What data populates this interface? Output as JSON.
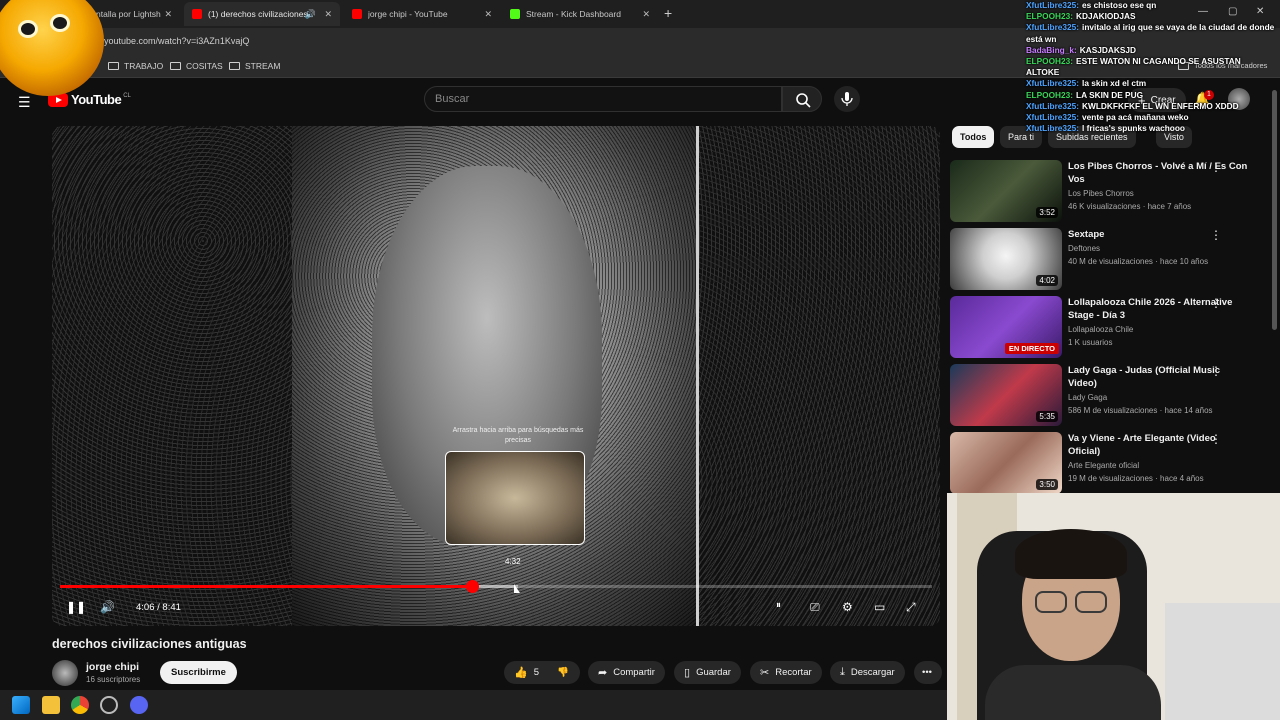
{
  "browser": {
    "tabs": [
      {
        "label": "ntalla por Lightsh",
        "active": false
      },
      {
        "label": "(1) derechos civilizaciones a",
        "active": true
      },
      {
        "label": "jorge chipi - YouTube",
        "active": false
      },
      {
        "label": "Stream - Kick Dashboard",
        "active": false
      }
    ],
    "url": "youtube.com/watch?v=i3AZn1KvajQ",
    "bookmarks": [
      "TRABAJO",
      "COSITAS",
      "STREAM"
    ],
    "all_bookmarks": "Todos los marcadores"
  },
  "youtube": {
    "logo": "YouTube",
    "country": "CL",
    "search_placeholder": "Buscar",
    "create_label": "Crear",
    "notif_count": "1"
  },
  "player": {
    "current_time": "4:06",
    "duration": "8:41",
    "time_display": "4:06 / 8:41",
    "progress_fraction": 0.473,
    "hover_time": "4:32",
    "hover_fraction": 0.525,
    "drag_hint": "Arrastra hacia arriba para búsquedas más precisas"
  },
  "video": {
    "title": "derechos civilizaciones antiguas",
    "channel": "jorge chipi",
    "subscribers": "16 suscriptores",
    "subscribe_label": "Suscribirme",
    "likes": "5",
    "share": "Compartir",
    "save": "Guardar",
    "clip": "Recortar",
    "download": "Descargar"
  },
  "sidebar": {
    "chips": [
      "Todos",
      "Para ti",
      "Subidas recientes",
      "Visto"
    ],
    "recs": [
      {
        "title": "Los Pibes Chorros - Volvé a Mí / Es Con Vos",
        "channel": "Los Pibes Chorros",
        "meta": "46 K visualizaciones · hace 7 años",
        "duration": "3:52"
      },
      {
        "title": "Sextape",
        "channel": "Deftones",
        "meta": "40 M de visualizaciones · hace 10 años",
        "duration": "4:02"
      },
      {
        "title": "Lollapalooza Chile 2026 - Alternative Stage - Día 3",
        "channel": "Lollapalooza Chile",
        "meta": "1 K usuarios",
        "live": "EN DIRECTO"
      },
      {
        "title": "Lady Gaga - Judas (Official Music Video)",
        "channel": "Lady Gaga",
        "meta": "586 M de visualizaciones · hace 14 años",
        "duration": "5:35"
      },
      {
        "title": "Va y Viene - Arte Elegante (Video Oficial)",
        "channel": "Arte Elegante oficial",
        "meta": "19 M de visualizaciones · hace 4 años",
        "duration": "3:50"
      }
    ]
  },
  "chat": [
    {
      "user": "XfutLibre325:",
      "text": "es chistoso ese qn",
      "color": "#4ea3ff"
    },
    {
      "user": "ELPOOH23:",
      "text": "KDJAKIODJAS",
      "color": "#3ad65a"
    },
    {
      "user": "XfutLibre325:",
      "text": "invitalo al irig que se vaya de la ciudad de donde está wn",
      "color": "#4ea3ff"
    },
    {
      "user": "BadaBing_k:",
      "text": "KASJDAKSJD",
      "color": "#c77dff"
    },
    {
      "user": "ELPOOH23:",
      "text": "ESTE WATON NI CAGANDO SE ASUSTAN ALTOKE",
      "color": "#3ad65a"
    },
    {
      "user": "XfutLibre325:",
      "text": "la skin xd el ctm",
      "color": "#4ea3ff"
    },
    {
      "user": "ELPOOH23:",
      "text": "LA SKIN DE PUG",
      "color": "#3ad65a"
    },
    {
      "user": "XfutLibre325:",
      "text": "KWLDKFKFKF EL WN ENFERMO XDDD",
      "color": "#4ea3ff"
    },
    {
      "user": "XfutLibre325:",
      "text": "vente pa acá mañana weko",
      "color": "#4ea3ff"
    },
    {
      "user": "XfutLibre325:",
      "text": "l fricas's spunks wachooo",
      "color": "#4ea3ff"
    }
  ]
}
